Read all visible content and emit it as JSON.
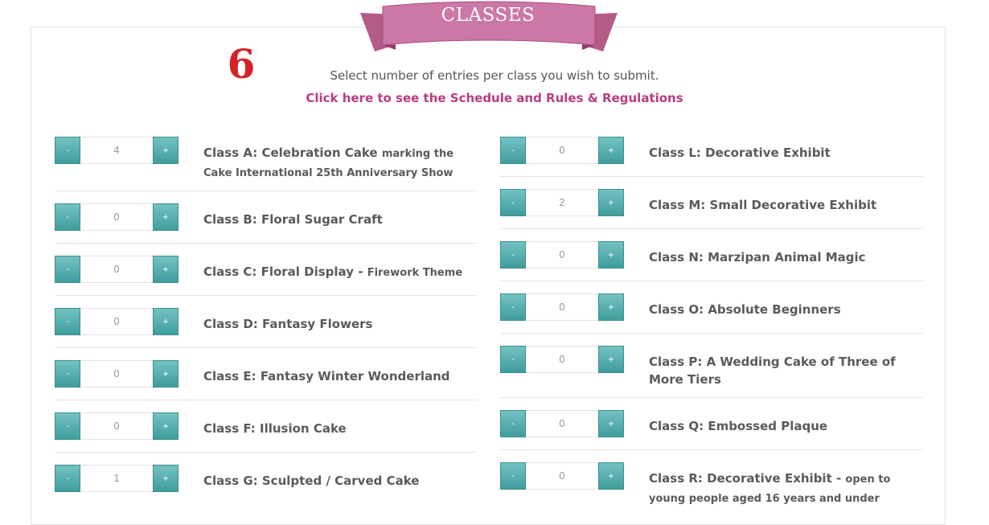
{
  "header": {
    "banner_title": "CLASSES",
    "step_number": "6",
    "instructions": "Select number of entries per class you wish to submit.",
    "schedule_link": "Click here to see the Schedule and Rules & Regulations"
  },
  "stepper": {
    "minus_label": "-",
    "plus_label": "+"
  },
  "colors": {
    "banner": "#c96ea0",
    "accent_link": "#b83c82",
    "step_number": "#d82126",
    "button": "#4fa8a8"
  },
  "left_classes": [
    {
      "title": "Class A: Celebration Cake",
      "subtitle": "marking the Cake International 25th Anniversary Show",
      "value": "4"
    },
    {
      "title": "Class B: Floral Sugar Craft",
      "subtitle": "",
      "value": "0"
    },
    {
      "title": "Class C: Floral Display -",
      "subtitle": "Firework Theme",
      "value": "0"
    },
    {
      "title": "Class D: Fantasy Flowers",
      "subtitle": "",
      "value": "0"
    },
    {
      "title": "Class E: Fantasy Winter Wonderland",
      "subtitle": "",
      "value": "0"
    },
    {
      "title": "Class F: Illusion Cake",
      "subtitle": "",
      "value": "0"
    },
    {
      "title": "Class G: Sculpted / Carved Cake",
      "subtitle": "",
      "value": "1"
    }
  ],
  "right_classes": [
    {
      "title": "Class L: Decorative Exhibit",
      "subtitle": "",
      "value": "0"
    },
    {
      "title": "Class M: Small Decorative Exhibit",
      "subtitle": "",
      "value": "2"
    },
    {
      "title": "Class N: Marzipan Animal Magic",
      "subtitle": "",
      "value": "0"
    },
    {
      "title": "Class O: Absolute Beginners",
      "subtitle": "",
      "value": "0"
    },
    {
      "title": "Class P: A Wedding Cake of Three of More Tiers",
      "subtitle": "",
      "value": "0"
    },
    {
      "title": "Class Q: Embossed Plaque",
      "subtitle": "",
      "value": "0"
    },
    {
      "title": "Class R: Decorative Exhibit -",
      "subtitle": "open to young people aged 16 years and under",
      "value": "0"
    }
  ]
}
